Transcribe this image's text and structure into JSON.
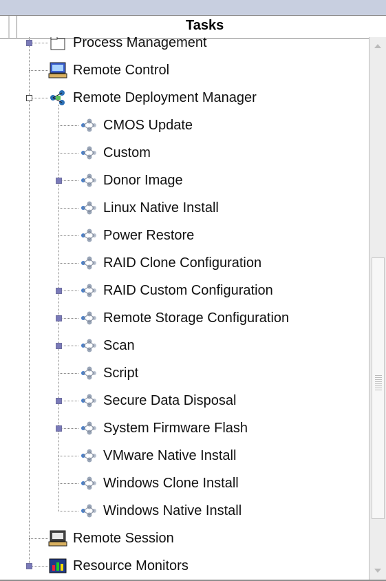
{
  "header": {
    "title": "Tasks"
  },
  "tree": {
    "items": [
      {
        "label": "Process Management",
        "level": 0,
        "icon": "folder-icon",
        "expander": "collapsed"
      },
      {
        "label": "Remote Control",
        "level": 0,
        "icon": "remote-control-icon",
        "expander": "none"
      },
      {
        "label": "Remote Deployment Manager",
        "level": 0,
        "icon": "network-deploy-icon",
        "expander": "expanded"
      },
      {
        "label": "CMOS Update",
        "level": 1,
        "icon": "deploy-task-icon",
        "expander": "none"
      },
      {
        "label": "Custom",
        "level": 1,
        "icon": "deploy-task-icon",
        "expander": "none"
      },
      {
        "label": "Donor Image",
        "level": 1,
        "icon": "deploy-task-icon",
        "expander": "collapsed"
      },
      {
        "label": "Linux Native Install",
        "level": 1,
        "icon": "deploy-task-icon",
        "expander": "none"
      },
      {
        "label": "Power Restore",
        "level": 1,
        "icon": "deploy-task-icon",
        "expander": "none"
      },
      {
        "label": "RAID Clone Configuration",
        "level": 1,
        "icon": "deploy-task-icon",
        "expander": "none"
      },
      {
        "label": "RAID Custom Configuration",
        "level": 1,
        "icon": "deploy-task-icon",
        "expander": "collapsed"
      },
      {
        "label": "Remote Storage Configuration",
        "level": 1,
        "icon": "deploy-task-icon",
        "expander": "collapsed"
      },
      {
        "label": "Scan",
        "level": 1,
        "icon": "deploy-task-icon",
        "expander": "collapsed"
      },
      {
        "label": "Script",
        "level": 1,
        "icon": "deploy-task-icon",
        "expander": "none"
      },
      {
        "label": "Secure Data Disposal",
        "level": 1,
        "icon": "deploy-task-icon",
        "expander": "collapsed"
      },
      {
        "label": "System Firmware Flash",
        "level": 1,
        "icon": "deploy-task-icon",
        "expander": "collapsed"
      },
      {
        "label": "VMware Native Install",
        "level": 1,
        "icon": "deploy-task-icon",
        "expander": "none"
      },
      {
        "label": "Windows Clone Install",
        "level": 1,
        "icon": "deploy-task-icon",
        "expander": "none"
      },
      {
        "label": "Windows Native Install",
        "level": 1,
        "icon": "deploy-task-icon",
        "expander": "none"
      },
      {
        "label": "Remote Session",
        "level": 0,
        "icon": "remote-session-icon",
        "expander": "none"
      },
      {
        "label": "Resource Monitors",
        "level": 0,
        "icon": "monitor-chart-icon",
        "expander": "collapsed"
      }
    ]
  },
  "colors": {
    "topbar": "#c8cfe0",
    "expander_fill": "#7a7ab8",
    "tree_line": "#808080"
  }
}
